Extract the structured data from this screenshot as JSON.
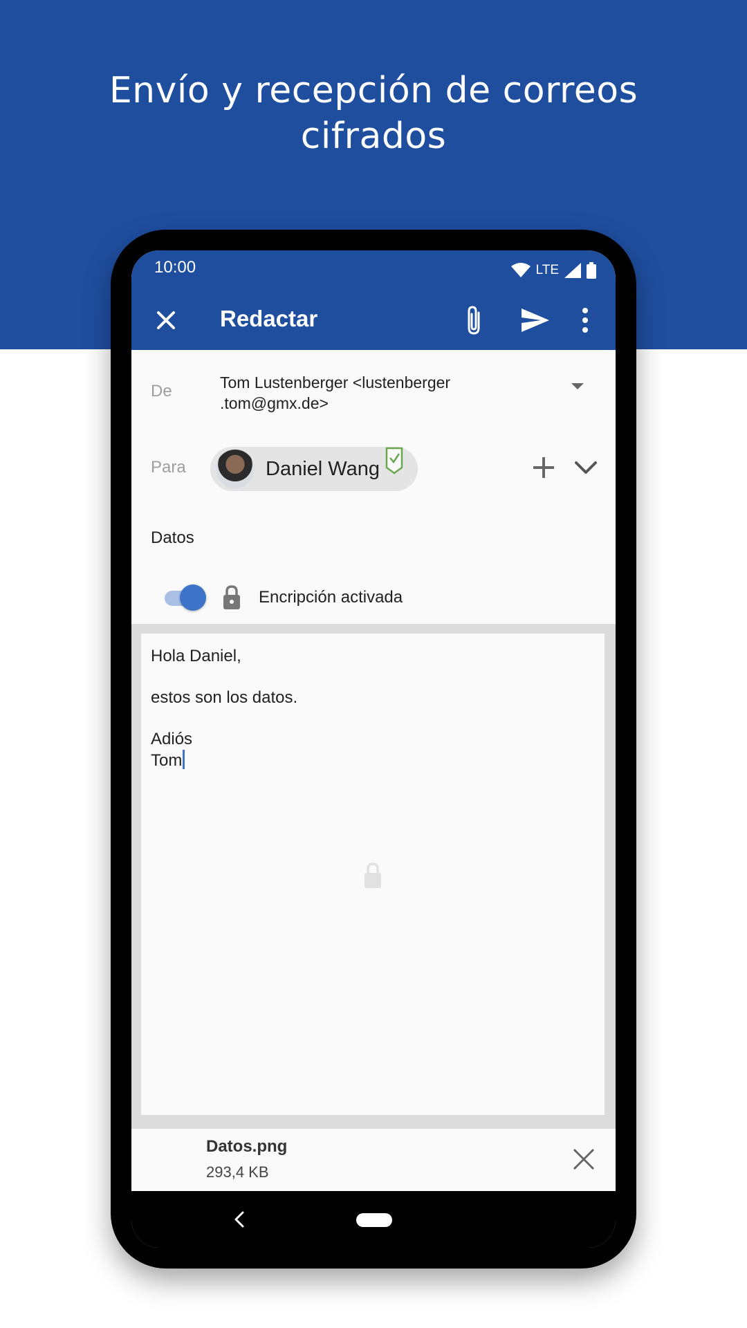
{
  "hero": {
    "title_line1": "Envío y recepción de correos",
    "title_line2": "cifrados"
  },
  "status_bar": {
    "time": "10:00",
    "network": "LTE"
  },
  "toolbar": {
    "title": "Redactar",
    "icons": [
      "close-icon",
      "paperclip-icon",
      "send-icon",
      "more-vert-icon"
    ]
  },
  "compose": {
    "from_label": "De",
    "from_line1": "Tom Lustenberger <lustenberger",
    "from_line2": ".tom@gmx.de>",
    "to_label": "Para",
    "recipient_name": "Daniel Wang",
    "subject": "Datos",
    "encryption_label": "Encripción activada",
    "encryption_enabled": true,
    "body": "Hola Daniel,\n\nestos son los datos.\n\nAdiós\nTom"
  },
  "attachment": {
    "name": "Datos.png",
    "size": "293,4 KB"
  },
  "colors": {
    "brand_blue": "#1f4e9f",
    "accent_blue": "#3d74c8",
    "verified_green": "#6aa84f"
  }
}
